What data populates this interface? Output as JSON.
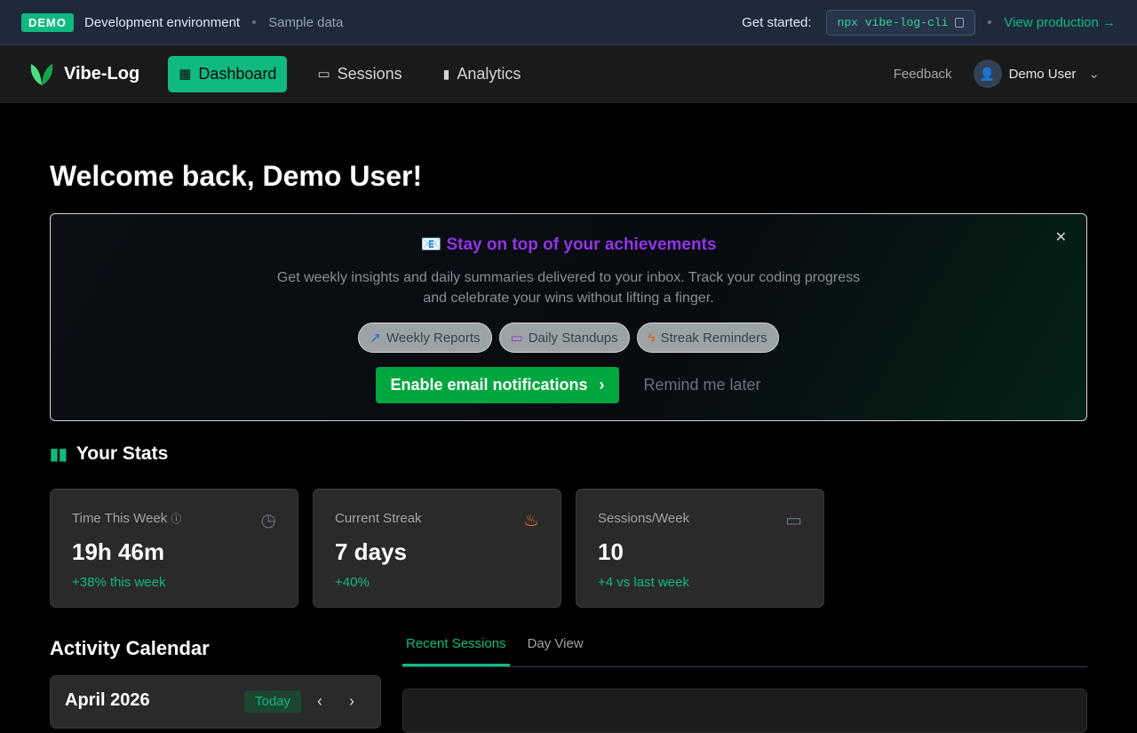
{
  "topbar": {
    "badge": "DEMO",
    "env": "Development environment",
    "sample": "Sample data",
    "get_started": "Get started:",
    "cli": "npx vibe-log-cli",
    "view_production": "View production →"
  },
  "nav": {
    "brand": "Vibe-Log",
    "items": [
      {
        "label": "Dashboard"
      },
      {
        "label": "Sessions"
      },
      {
        "label": "Analytics"
      }
    ],
    "feedback": "Feedback",
    "user": "Demo User"
  },
  "welcome": "Welcome back, Demo User!",
  "promo": {
    "icon": "📧",
    "title": "Stay on top of your achievements",
    "description": "Get weekly insights and daily summaries delivered to your inbox. Track your coding progress and celebrate your wins without lifting a finger.",
    "chips": [
      "Weekly Reports",
      "Daily Standups",
      "Streak Reminders"
    ],
    "enable": "Enable email notifications",
    "later": "Remind me later",
    "close": "✕"
  },
  "stats": {
    "title": "Your Stats",
    "cards": [
      {
        "label": "Time This Week",
        "value": "19h 46m",
        "change": "+38% this week"
      },
      {
        "label": "Current Streak",
        "value": "7 days",
        "change": "+40%"
      },
      {
        "label": "Sessions/Week",
        "value": "10",
        "change": "+4 vs last week"
      }
    ]
  },
  "calendar": {
    "title": "Activity Calendar",
    "month": "April 2026",
    "today": "Today"
  },
  "tabs": [
    "Recent Sessions",
    "Day View"
  ],
  "colors": {
    "accent": "#10b981",
    "purple": "#9333ea",
    "cta": "#00a63e"
  }
}
